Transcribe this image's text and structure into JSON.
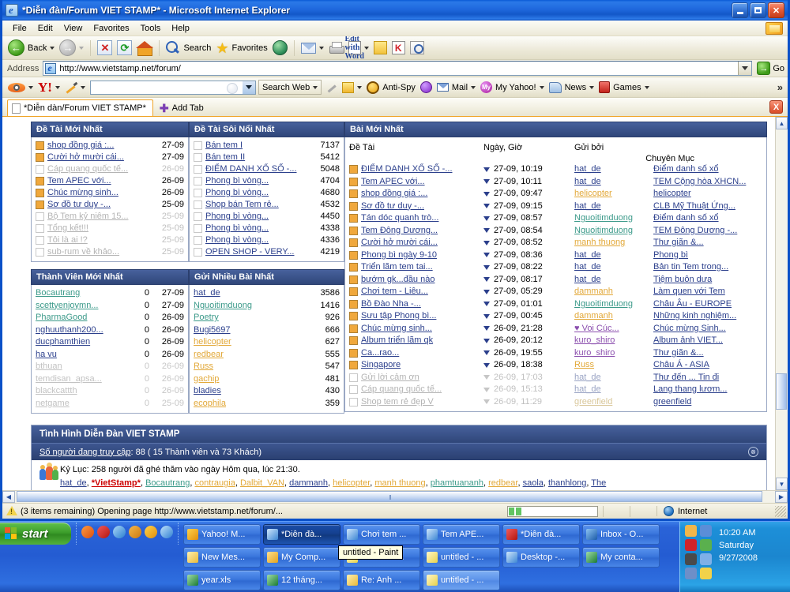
{
  "window": {
    "title": "*Diễn đàn/Forum VIET STAMP* - Microsoft Internet Explorer",
    "minimize_label": "Minimize",
    "maximize_label": "Maximize",
    "close_label": "Close"
  },
  "menu": {
    "items": [
      "File",
      "Edit",
      "View",
      "Favorites",
      "Tools",
      "Help"
    ]
  },
  "toolbar": {
    "back_label": "Back",
    "forward_label": "Forward",
    "stop_label": "Stop",
    "refresh_label": "Refresh",
    "home_label": "Home",
    "search_label": "Search",
    "favorites_label": "Favorites",
    "media_label": "Media",
    "mail_label": "Mail",
    "print_label": "Print",
    "edit_word_label": "Edit with Word",
    "notes_label": "Notes",
    "k_label": "K",
    "research_label": "Research"
  },
  "address": {
    "label": "Address",
    "value": "http://www.vietstamp.net/forum/",
    "go_label": "Go"
  },
  "yahoo_toolbar": {
    "search_value": "",
    "search_web_label": "Search Web",
    "anti_spy_label": "Anti-Spy",
    "mail_label": "Mail",
    "my_yahoo_label": "My Yahoo!",
    "news_label": "News",
    "games_label": "Games",
    "overflow_label": "»"
  },
  "tabs": {
    "items": [
      {
        "label": "*Diễn dàn/Forum VIET STAMP*",
        "active": true
      }
    ],
    "add_tab_label": "Add Tab",
    "close_label": "X"
  },
  "forum": {
    "de_tai_moi_nhat": {
      "title": "Đề Tài Mới Nhất",
      "rows": [
        {
          "title": "shop đồng giá :...",
          "date": "27-09",
          "read": false,
          "dim": false
        },
        {
          "title": "Cười hở mười cái...",
          "date": "27-09",
          "read": false,
          "dim": false
        },
        {
          "title": "Cáp quang quốc tế...",
          "date": "26-09",
          "read": true,
          "dim": true
        },
        {
          "title": "Tem APEC với...",
          "date": "26-09",
          "read": false,
          "dim": false
        },
        {
          "title": "Chúc mừng sinh...",
          "date": "26-09",
          "read": false,
          "dim": false
        },
        {
          "title": "Sơ đồ tư duy -...",
          "date": "25-09",
          "read": false,
          "dim": false
        },
        {
          "title": "Bộ Tem kỷ niêm 15...",
          "date": "25-09",
          "read": true,
          "dim": true
        },
        {
          "title": "Tổng kết!!!",
          "date": "25-09",
          "read": true,
          "dim": true
        },
        {
          "title": "Tôi là ai !?",
          "date": "25-09",
          "read": true,
          "dim": true
        },
        {
          "title": "sub-rum về khảo...",
          "date": "25-09",
          "read": true,
          "dim": true
        }
      ]
    },
    "de_tai_soi_noi_nhat": {
      "title": "Đề Tài Sôi Nổi Nhất",
      "rows": [
        {
          "title": "Bán tem I",
          "count": "7137"
        },
        {
          "title": "Bán tem II",
          "count": "5412"
        },
        {
          "title": "ĐIỂM DANH XỔ SỐ -...",
          "count": "5048"
        },
        {
          "title": "Phong bì vòng...",
          "count": "4704"
        },
        {
          "title": "Phong bì vòng...",
          "count": "4680"
        },
        {
          "title": "Shop bán Tem rẻ...",
          "count": "4532"
        },
        {
          "title": "Phong bì vòng...",
          "count": "4450"
        },
        {
          "title": "Phong bì vòng...",
          "count": "4338"
        },
        {
          "title": "Phong bì vòng...",
          "count": "4336"
        },
        {
          "title": "OPEN SHOP - VERY...",
          "count": "4219"
        }
      ]
    },
    "bai_moi_nhat": {
      "title": "Bài Mới Nhất",
      "headers": {
        "de_tai": "Đề Tài",
        "ngay_gio": "Ngày, Giờ",
        "gui_boi": "Gửi bởi",
        "chuyen_muc": "Chuyên Mục"
      },
      "rows": [
        {
          "de_tai": "ĐIỂM DANH XỔ SỐ -...",
          "ngay": "27-09, 10:19",
          "gui": "hat_de",
          "gui_color": "#2b3f8c",
          "chuyen": "Điểm danh số xổ",
          "read": false,
          "dim": false
        },
        {
          "de_tai": "Tem APEC với...",
          "ngay": "27-09, 10:11",
          "gui": "hat_de",
          "gui_color": "#2b3f8c",
          "chuyen": "TEM Cộng hòa XHCN...",
          "read": false,
          "dim": false
        },
        {
          "de_tai": "shop đồng giá :...",
          "ngay": "27-09, 09:47",
          "gui": "helicopter",
          "gui_color": "#e2a838",
          "chuyen": "helicopter",
          "read": false,
          "dim": false
        },
        {
          "de_tai": "Sơ đồ tư duy -...",
          "ngay": "27-09, 09:15",
          "gui": "hat_de",
          "gui_color": "#2b3f8c",
          "chuyen": "CLB Mỹ Thuật Ứng...",
          "read": false,
          "dim": false
        },
        {
          "de_tai": "Tán dóc quanh trò...",
          "ngay": "27-09, 08:57",
          "gui": "Nguoitimduong",
          "gui_color": "#3c9a8a",
          "chuyen": "Điểm danh số xổ",
          "read": false,
          "dim": false
        },
        {
          "de_tai": "Tem Đông Dương...",
          "ngay": "27-09, 08:54",
          "gui": "Nguoitimduong",
          "gui_color": "#3c9a8a",
          "chuyen": "TEM Đông Dương -...",
          "read": false,
          "dim": false
        },
        {
          "de_tai": "Cười hở mười cái...",
          "ngay": "27-09, 08:52",
          "gui": "manh thuong",
          "gui_color": "#e2a838",
          "chuyen": "Thư giãn &...",
          "read": false,
          "dim": false
        },
        {
          "de_tai": "Phong bì ngày 9-10",
          "ngay": "27-09, 08:36",
          "gui": "hat_de",
          "gui_color": "#2b3f8c",
          "chuyen": "Phong bì",
          "read": false,
          "dim": false
        },
        {
          "de_tai": "Triển lãm tem tai...",
          "ngay": "27-09, 08:22",
          "gui": "hat_de",
          "gui_color": "#2b3f8c",
          "chuyen": "Bản tin Tem trong...",
          "read": false,
          "dim": false
        },
        {
          "de_tai": "bướm gk...đầu nào",
          "ngay": "27-09, 08:17",
          "gui": "hat_de",
          "gui_color": "#2b3f8c",
          "chuyen": "Tiệm buôn dưa",
          "read": false,
          "dim": false
        },
        {
          "de_tai": "Chơi tem - Liêu...",
          "ngay": "27-09, 05:29",
          "gui": "dammanh",
          "gui_color": "#e2a838",
          "chuyen": "Làm quen với Tem",
          "read": false,
          "dim": false
        },
        {
          "de_tai": "Bồ Đào Nha -...",
          "ngay": "27-09, 01:01",
          "gui": "Nguoitimduong",
          "gui_color": "#3c9a8a",
          "chuyen": "Châu Âu - EUROPE",
          "read": false,
          "dim": false
        },
        {
          "de_tai": "Sưu tập Phong bì...",
          "ngay": "27-09, 00:45",
          "gui": "dammanh",
          "gui_color": "#e2a838",
          "chuyen": "Những kinh nghiệm...",
          "read": false,
          "dim": false
        },
        {
          "de_tai": "Chúc mừng sinh...",
          "ngay": "26-09, 21:28",
          "gui": "♥ Voi Cúc...",
          "gui_color": "#8b4fae",
          "chuyen": "Chúc mừng Sinh...",
          "read": false,
          "dim": false
        },
        {
          "de_tai": "Album triển lãm qk",
          "ngay": "26-09, 20:12",
          "gui": "kuro_shiro",
          "gui_color": "#8b4fae",
          "chuyen": "Album ảnh VIET...",
          "read": false,
          "dim": false
        },
        {
          "de_tai": "Ca...rao...",
          "ngay": "26-09, 19:55",
          "gui": "kuro_shiro",
          "gui_color": "#8b4fae",
          "chuyen": "Thư giãn &...",
          "read": false,
          "dim": false
        },
        {
          "de_tai": "Singapore",
          "ngay": "26-09, 18:38",
          "gui": "Russ",
          "gui_color": "#e2a838",
          "chuyen": "Châu Á - ASIA",
          "read": false,
          "dim": false
        },
        {
          "de_tai": "Gửi lời cảm ơn",
          "ngay": "26-09, 17:03",
          "gui": "hat_de",
          "gui_color": "#2b3f8c",
          "chuyen": "Thư đến ... Tin đi",
          "read": true,
          "dim": true
        },
        {
          "de_tai": "Cáp quang quốc tế...",
          "ngay": "26-09, 15:13",
          "gui": "hat_de",
          "gui_color": "#2b3f8c",
          "chuyen": "Lang thang lươm...",
          "read": true,
          "dim": true
        },
        {
          "de_tai": "Shop tem rẻ đẹp V",
          "ngay": "26-09, 11:29",
          "gui": "greenfield",
          "gui_color": "#e2a838",
          "chuyen": "greenfield",
          "read": true,
          "dim": true
        }
      ]
    },
    "thanh_vien_moi_nhat": {
      "title": "Thành Viên Mới Nhất",
      "rows": [
        {
          "name": "Bocautrang",
          "count": "0",
          "date": "27-09",
          "color": "#3c9a8a",
          "dim": false
        },
        {
          "name": "scettyenjoymn...",
          "count": "0",
          "date": "27-09",
          "color": "#3c9a8a",
          "dim": false
        },
        {
          "name": "PharmaGood",
          "count": "0",
          "date": "26-09",
          "color": "#3c9a8a",
          "dim": false
        },
        {
          "name": "nghuuthanh200...",
          "count": "0",
          "date": "26-09",
          "color": "#2b3f8c",
          "dim": false
        },
        {
          "name": "ducphamthien",
          "count": "0",
          "date": "26-09",
          "color": "#2b3f8c",
          "dim": false
        },
        {
          "name": "ha vu",
          "count": "0",
          "date": "26-09",
          "color": "#2b3f8c",
          "dim": false
        },
        {
          "name": "bthuan",
          "count": "0",
          "date": "26-09",
          "color": "#2b3f8c",
          "dim": true
        },
        {
          "name": "temdisan_apsa...",
          "count": "0",
          "date": "26-09",
          "color": "#2b3f8c",
          "dim": true
        },
        {
          "name": "blackcattth",
          "count": "0",
          "date": "26-09",
          "color": "#2b3f8c",
          "dim": true
        },
        {
          "name": "netgame",
          "count": "0",
          "date": "25-09",
          "color": "#2b3f8c",
          "dim": true
        }
      ]
    },
    "gui_nhieu_bai_nhat": {
      "title": "Gửi Nhiều Bài Nhất",
      "rows": [
        {
          "name": "hat_de",
          "count": "3586",
          "color": "#2b3f8c"
        },
        {
          "name": "Nguoitimduong",
          "count": "1416",
          "color": "#3c9a8a"
        },
        {
          "name": "Poetry",
          "count": "926",
          "color": "#3c9a8a"
        },
        {
          "name": "Bugi5697",
          "count": "666",
          "color": "#2b3f8c"
        },
        {
          "name": "helicopter",
          "count": "627",
          "color": "#e2a838"
        },
        {
          "name": "redbear",
          "count": "555",
          "color": "#e2a838"
        },
        {
          "name": "Russ",
          "count": "547",
          "color": "#e2a838"
        },
        {
          "name": "gachip",
          "count": "481",
          "color": "#e2a838"
        },
        {
          "name": "bladies",
          "count": "430",
          "color": "#2b3f8c"
        },
        {
          "name": "ecophila",
          "count": "359",
          "color": "#e2a838"
        }
      ]
    },
    "stats": {
      "title": "Tình Hình Diễn Đàn VIET STAMP",
      "online_prefix": "Số người đang truy cập",
      "online_text": ": 88 ( 15 Thành viên và 73 Khách)",
      "online_count": "88",
      "members_count": "15",
      "guests_count": "73",
      "record_line": "Kỷ Lục: 258 người đã ghé thăm vào ngày Hôm qua, lúc 21:30.",
      "users": [
        {
          "name": "hat_de",
          "color": "#2b3f8c",
          "bold": false
        },
        {
          "name": "*VietStamp*",
          "color": "#cc0000",
          "bold": true
        },
        {
          "name": "Bocautrang",
          "color": "#3c9a8a",
          "bold": false
        },
        {
          "name": "contraugia",
          "color": "#e2a838",
          "bold": false
        },
        {
          "name": "Dalbit_VAN",
          "color": "#e2a838",
          "bold": false
        },
        {
          "name": "dammanh",
          "color": "#2b3f8c",
          "bold": false
        },
        {
          "name": "helicopter",
          "color": "#e2a838",
          "bold": false
        },
        {
          "name": "manh thuong",
          "color": "#e2a838",
          "bold": false
        },
        {
          "name": "phamtuananh",
          "color": "#3c9a8a",
          "bold": false
        },
        {
          "name": "redbear",
          "color": "#e2a838",
          "bold": false
        },
        {
          "name": "saola",
          "color": "#2b3f8c",
          "bold": false
        },
        {
          "name": "thanhlong",
          "color": "#2b3f8c",
          "bold": false
        },
        {
          "name": "The",
          "color": "#2b3f8c",
          "bold": false
        }
      ],
      "collapse_label": "⊗"
    }
  },
  "statusbar": {
    "text": "(3 items remaining) Opening page http://www.vietstamp.net/forum/...",
    "zone": "Internet"
  },
  "taskbar": {
    "start_label": "start",
    "quicklaunch": [
      "firefox-icon",
      "opera-icon",
      "ie-shortcut-icon",
      "media-icon",
      "yahoo-messenger-icon",
      "internet-explorer-icon"
    ],
    "row1": [
      {
        "label": "Yahoo! M...",
        "icon": "yahoo-messenger-icon",
        "state": "normal"
      },
      {
        "label": "*Diễn đà...",
        "icon": "ie-icon",
        "state": "active"
      },
      {
        "label": "Chơi tem ...",
        "icon": "ie-icon",
        "state": "normal"
      },
      {
        "label": "Tem APE...",
        "icon": "ie-icon",
        "state": "normal"
      },
      {
        "label": "*Diễn đà...",
        "icon": "opera-icon",
        "state": "normal"
      },
      {
        "label": "Inbox - O...",
        "icon": "outlook-icon",
        "state": "normal"
      }
    ],
    "row2": [
      {
        "label": "New Mes...",
        "icon": "message-icon",
        "state": "normal"
      },
      {
        "label": "My Comp...",
        "icon": "folder-icon",
        "state": "normal"
      },
      {
        "label": "untitled - ...",
        "icon": "paint-icon",
        "state": "normal"
      },
      {
        "label": "untitled - ...",
        "icon": "paint-icon",
        "state": "normal"
      },
      {
        "label": "Desktop -...",
        "icon": "ie-icon",
        "state": "normal"
      },
      {
        "label": "My conta...",
        "icon": "excel-icon",
        "state": "normal"
      }
    ],
    "row3": [
      {
        "label": "year.xls",
        "icon": "excel-icon",
        "state": "normal"
      },
      {
        "label": "12 tháng...",
        "icon": "excel-icon",
        "state": "normal"
      },
      {
        "label": "Re: Anh ...",
        "icon": "message-icon",
        "state": "normal"
      },
      {
        "label": "untitled - ...",
        "icon": "paint-icon",
        "state": "light"
      }
    ],
    "tooltip": "untitled - Paint",
    "clock": {
      "time": "10:20 AM",
      "day": "Saturday",
      "date": "9/27/2008"
    }
  }
}
